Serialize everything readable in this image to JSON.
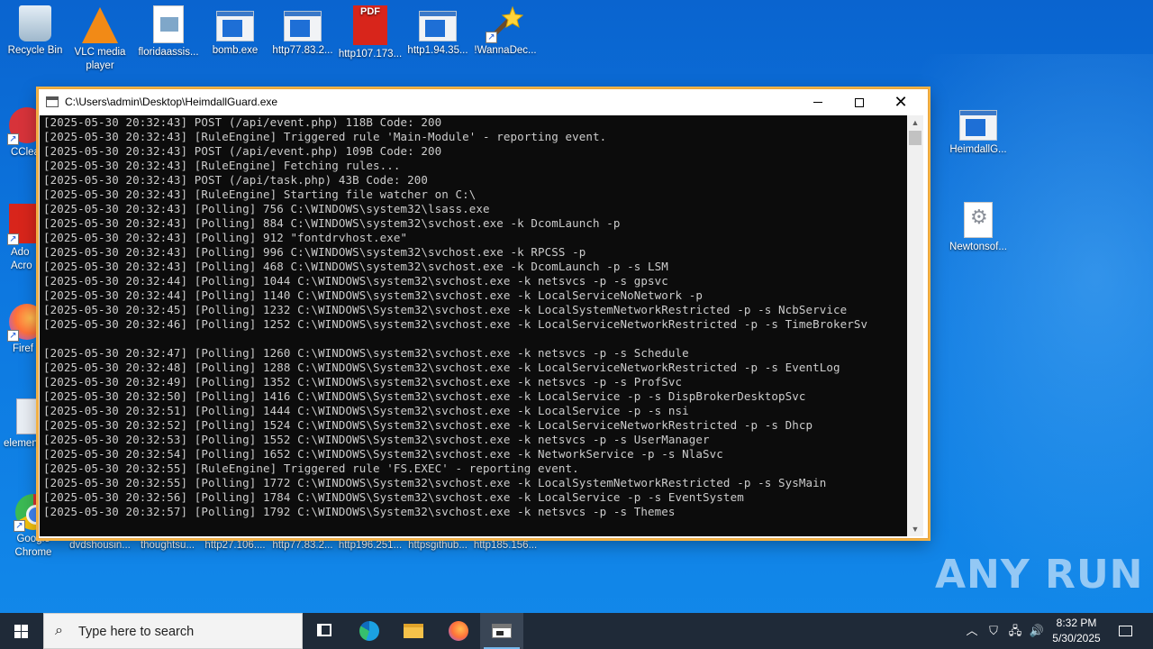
{
  "desktop": {
    "icons_top": [
      {
        "label": "Recycle Bin",
        "kind": "recycle-bin-icon"
      },
      {
        "label": "VLC media player",
        "kind": "vlc-icon"
      },
      {
        "label": "floridaassis...",
        "kind": "image-file-icon"
      },
      {
        "label": "bomb.exe",
        "kind": "exe-file-icon"
      },
      {
        "label": "http77.83.2...",
        "kind": "exe-file-icon"
      },
      {
        "label": "http107.173...",
        "kind": "pdf-file-icon"
      },
      {
        "label": "http1.94.35...",
        "kind": "exe-file-icon"
      },
      {
        "label": "!WannaDec...",
        "kind": "wand-icon"
      }
    ],
    "icons_left": [
      {
        "label": "CClea",
        "kind": "ccleaner-icon"
      },
      {
        "label": "Ado Acro",
        "kind": "acrobat-icon"
      },
      {
        "label": "Firef",
        "kind": "firefox-icon"
      },
      {
        "label": "elemen",
        "kind": "element-file-icon"
      },
      {
        "label": "Google Chrome",
        "kind": "chrome-icon"
      }
    ],
    "icons_bottom": [
      {
        "label": "dvdshousin...",
        "kind": "file-icon"
      },
      {
        "label": "thoughtsu...",
        "kind": "file-icon"
      },
      {
        "label": "http27.106....",
        "kind": "file-icon"
      },
      {
        "label": "http77.83.2...",
        "kind": "file-icon"
      },
      {
        "label": "http196.251...",
        "kind": "file-icon"
      },
      {
        "label": "httpsgithub...",
        "kind": "file-icon"
      },
      {
        "label": "http185.156...",
        "kind": "file-icon"
      }
    ],
    "icons_right": [
      {
        "label": "HeimdallG...",
        "kind": "exe-file-icon"
      },
      {
        "label": "Newtonsof...",
        "kind": "settings-file-icon"
      }
    ],
    "watermark": "ANY RUN"
  },
  "console_window": {
    "title": "C:\\Users\\admin\\Desktop\\HeimdallGuard.exe",
    "lines": [
      "[2025-05-30 20:32:43] POST (/api/event.php) 118B Code: 200",
      "[2025-05-30 20:32:43] [RuleEngine] Triggered rule 'Main-Module' - reporting event.",
      "[2025-05-30 20:32:43] POST (/api/event.php) 109B Code: 200",
      "[2025-05-30 20:32:43] [RuleEngine] Fetching rules...",
      "[2025-05-30 20:32:43] POST (/api/task.php) 43B Code: 200",
      "[2025-05-30 20:32:43] [RuleEngine] Starting file watcher on C:\\",
      "[2025-05-30 20:32:43] [Polling] 756 C:\\WINDOWS\\system32\\lsass.exe",
      "[2025-05-30 20:32:43] [Polling] 884 C:\\WINDOWS\\system32\\svchost.exe -k DcomLaunch -p",
      "[2025-05-30 20:32:43] [Polling] 912 \"fontdrvhost.exe\"",
      "[2025-05-30 20:32:43] [Polling] 996 C:\\WINDOWS\\system32\\svchost.exe -k RPCSS -p",
      "[2025-05-30 20:32:43] [Polling] 468 C:\\WINDOWS\\system32\\svchost.exe -k DcomLaunch -p -s LSM",
      "[2025-05-30 20:32:44] [Polling] 1044 C:\\WINDOWS\\system32\\svchost.exe -k netsvcs -p -s gpsvc",
      "[2025-05-30 20:32:44] [Polling] 1140 C:\\WINDOWS\\system32\\svchost.exe -k LocalServiceNoNetwork -p",
      "[2025-05-30 20:32:45] [Polling] 1232 C:\\WINDOWS\\System32\\svchost.exe -k LocalSystemNetworkRestricted -p -s NcbService",
      "[2025-05-30 20:32:46] [Polling] 1252 C:\\WINDOWS\\system32\\svchost.exe -k LocalServiceNetworkRestricted -p -s TimeBrokerSv",
      "",
      "[2025-05-30 20:32:47] [Polling] 1260 C:\\WINDOWS\\system32\\svchost.exe -k netsvcs -p -s Schedule",
      "[2025-05-30 20:32:48] [Polling] 1288 C:\\WINDOWS\\System32\\svchost.exe -k LocalServiceNetworkRestricted -p -s EventLog",
      "[2025-05-30 20:32:49] [Polling] 1352 C:\\WINDOWS\\system32\\svchost.exe -k netsvcs -p -s ProfSvc",
      "[2025-05-30 20:32:50] [Polling] 1416 C:\\WINDOWS\\System32\\svchost.exe -k LocalService -p -s DispBrokerDesktopSvc",
      "[2025-05-30 20:32:51] [Polling] 1444 C:\\WINDOWS\\System32\\svchost.exe -k LocalService -p -s nsi",
      "[2025-05-30 20:32:52] [Polling] 1524 C:\\WINDOWS\\System32\\svchost.exe -k LocalServiceNetworkRestricted -p -s Dhcp",
      "[2025-05-30 20:32:53] [Polling] 1552 C:\\WINDOWS\\System32\\svchost.exe -k netsvcs -p -s UserManager",
      "[2025-05-30 20:32:54] [Polling] 1652 C:\\WINDOWS\\System32\\svchost.exe -k NetworkService -p -s NlaSvc",
      "[2025-05-30 20:32:55] [RuleEngine] Triggered rule 'FS.EXEC' - reporting event.",
      "[2025-05-30 20:32:55] [Polling] 1772 C:\\WINDOWS\\System32\\svchost.exe -k LocalSystemNetworkRestricted -p -s SysMain",
      "[2025-05-30 20:32:56] [Polling] 1784 C:\\WINDOWS\\System32\\svchost.exe -k LocalService -p -s EventSystem",
      "[2025-05-30 20:32:57] [Polling] 1792 C:\\WINDOWS\\System32\\svchost.exe -k netsvcs -p -s Themes"
    ]
  },
  "taskbar": {
    "search_placeholder": "Type here to search",
    "time": "8:32 PM",
    "date": "5/30/2025"
  },
  "colors": {
    "desktop_blue": "#0d78e0",
    "console_bg": "#0c0c0c",
    "console_text": "#cccccc",
    "window_border_accent": "#e8a33b",
    "taskbar_bg": "#1f2a38"
  }
}
